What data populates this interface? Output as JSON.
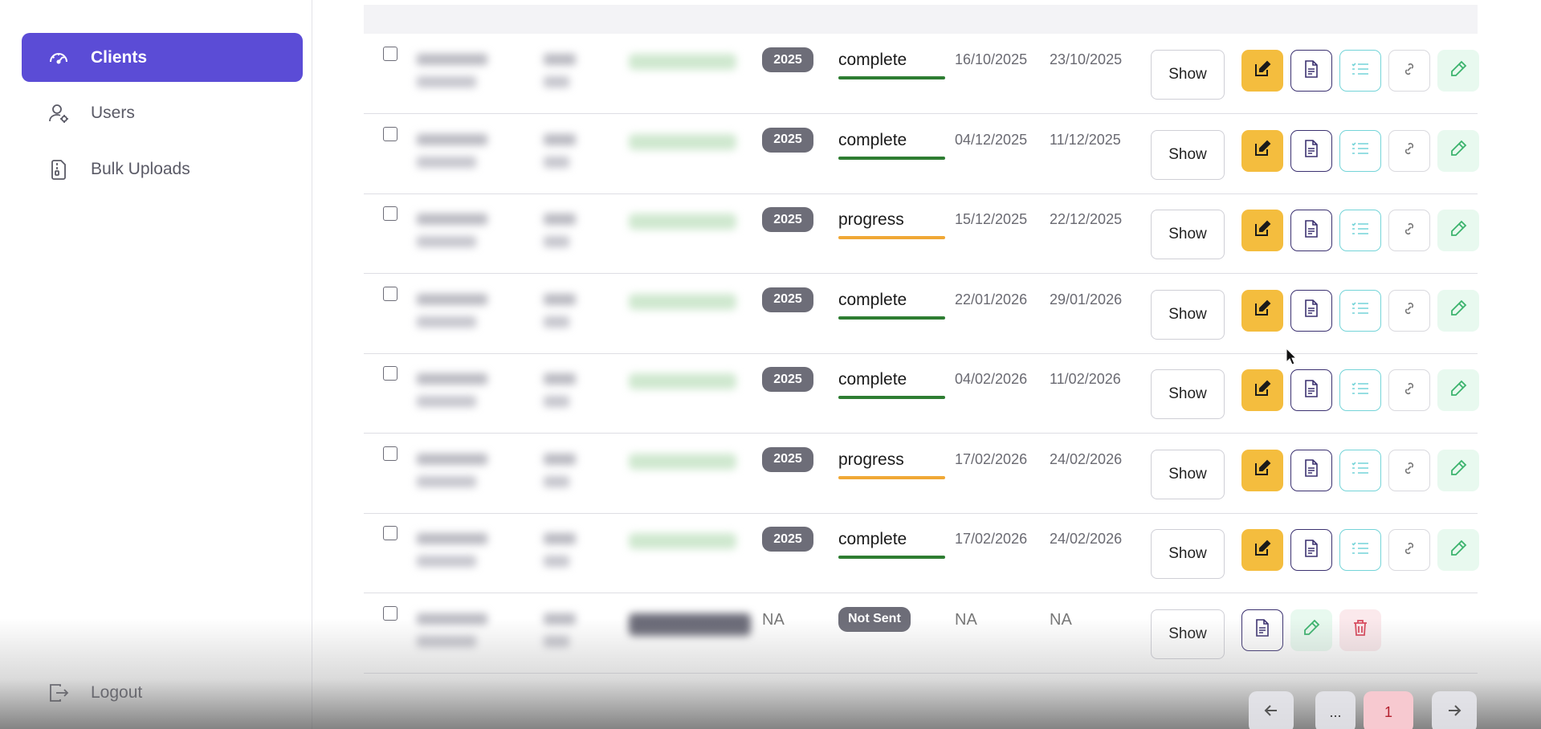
{
  "sidebar": {
    "items": [
      {
        "label": "Clients",
        "icon": "dashboard-gauge-icon",
        "active": true
      },
      {
        "label": "Users",
        "icon": "user-settings-icon",
        "active": false
      },
      {
        "label": "Bulk Uploads",
        "icon": "file-upload-icon",
        "active": false
      }
    ],
    "logout": {
      "label": "Logout",
      "icon": "logout-icon"
    }
  },
  "table": {
    "rows": [
      {
        "year": "2025",
        "status": "complete",
        "start_date": "16/10/2025",
        "end_date": "23/10/2025",
        "show_label": "Show"
      },
      {
        "year": "2025",
        "status": "complete",
        "start_date": "04/12/2025",
        "end_date": "11/12/2025",
        "show_label": "Show"
      },
      {
        "year": "2025",
        "status": "progress",
        "start_date": "15/12/2025",
        "end_date": "22/12/2025",
        "show_label": "Show"
      },
      {
        "year": "2025",
        "status": "complete",
        "start_date": "22/01/2026",
        "end_date": "29/01/2026",
        "show_label": "Show"
      },
      {
        "year": "2025",
        "status": "complete",
        "start_date": "04/02/2026",
        "end_date": "11/02/2026",
        "show_label": "Show"
      },
      {
        "year": "2025",
        "status": "progress",
        "start_date": "17/02/2026",
        "end_date": "24/02/2026",
        "show_label": "Show"
      },
      {
        "year": "2025",
        "status": "complete",
        "start_date": "17/02/2026",
        "end_date": "24/02/2026",
        "show_label": "Show"
      }
    ],
    "last_row": {
      "year": "NA",
      "status": "Not Sent",
      "start_date": "NA",
      "end_date": "NA",
      "show_label": "Show"
    }
  },
  "pagination": {
    "ellipsis": "...",
    "current_page": "1"
  },
  "colors": {
    "accent": "#5b4cd6",
    "complete": "#2e7d32",
    "progress": "#f0a836",
    "edit_button": "#f4bd3e",
    "badge": "#6d6d78"
  }
}
